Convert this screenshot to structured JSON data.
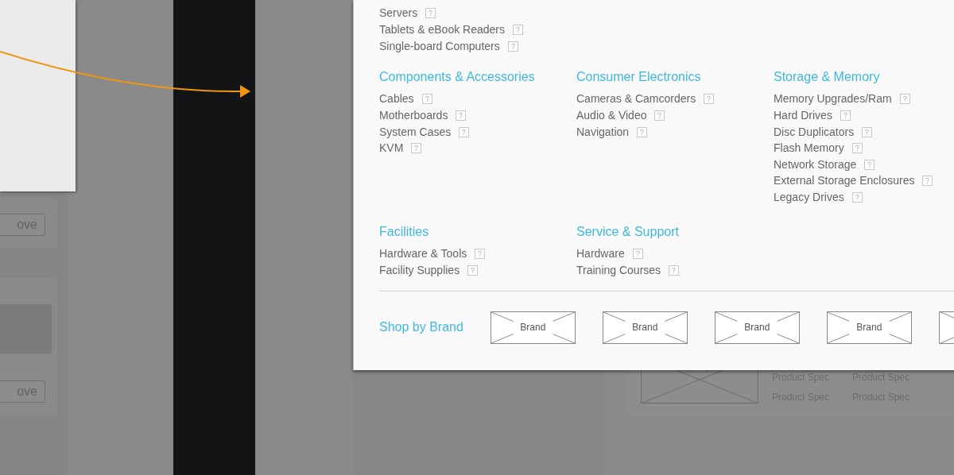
{
  "background": {
    "buttons": [
      "ove",
      "ove"
    ],
    "product_specs": [
      "Product Spec",
      "Product Spec",
      "Product Spec",
      "Product Spec"
    ]
  },
  "menu": {
    "top_items": [
      "Servers",
      "Tablets & eBook Readers",
      "Single-board Computers"
    ],
    "groups": [
      {
        "heading": "Components & Accessories",
        "items": [
          "Cables",
          "Motherboards",
          "System Cases",
          "KVM"
        ]
      },
      {
        "heading": "Consumer Electronics",
        "items": [
          "Cameras & Camcorders",
          "Audio & Video",
          "Navigation"
        ]
      },
      {
        "heading": "Storage & Memory",
        "items": [
          "Memory Upgrades/Ram",
          "Hard Drives",
          "Disc Duplicators",
          "Flash Memory",
          "Network Storage",
          "External Storage Enclosures",
          "Legacy Drives"
        ]
      },
      {
        "heading": "Facilities",
        "items": [
          "Hardware & Tools",
          "Facility Supplies"
        ]
      },
      {
        "heading": "Service & Support",
        "items": [
          "Hardware",
          "Training Courses"
        ]
      }
    ],
    "brand_heading": "Shop by Brand",
    "brands": [
      "Brand",
      "Brand",
      "Brand",
      "Brand"
    ]
  }
}
